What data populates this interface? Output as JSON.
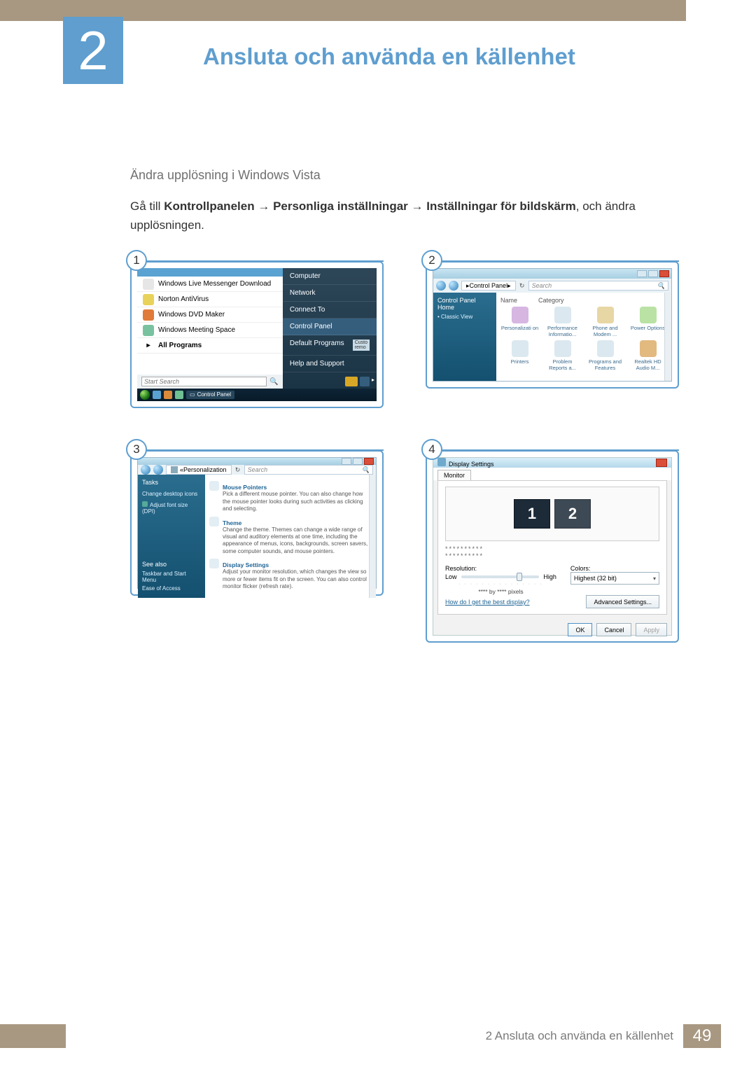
{
  "chapter": {
    "number": "2",
    "title": "Ansluta och använda en källenhet"
  },
  "section": {
    "subheading": "Ändra upplösning i Windows Vista",
    "intro_prefix": "Gå till ",
    "path_parts": [
      "Kontrollpanelen",
      "Personliga inställningar",
      "Inställningar för bildskärm"
    ],
    "intro_suffix": ", och ändra upplösningen."
  },
  "screens": {
    "s1": {
      "badge": "1",
      "left_items": [
        "Windows Live Messenger Download",
        "Norton AntiVirus",
        "Windows DVD Maker",
        "Windows Meeting Space"
      ],
      "all_programs": "All Programs",
      "search_placeholder": "Start Search",
      "right_items": [
        "Computer",
        "Network",
        "Connect To",
        "Control Panel",
        "Default Programs",
        "Help and Support"
      ],
      "right_highlight": "Control Panel",
      "right_side_label": "Custo\nremo",
      "taskbar_label": "Control Panel"
    },
    "s2": {
      "badge": "2",
      "breadcrumb": "Control Panel",
      "search_placeholder": "Search",
      "side_header": "Control Panel Home",
      "side_links": [
        "Classic View"
      ],
      "columns": [
        "Name",
        "Category"
      ],
      "items": [
        "Personalizati on",
        "Performance Informatio...",
        "Phone and Modem ...",
        "Power Options",
        "Printers",
        "Problem Reports a...",
        "Programs and Features",
        "Realtek HD Audio M..."
      ]
    },
    "s3": {
      "badge": "3",
      "breadcrumb": "Personalization",
      "search_placeholder": "Search",
      "side_header": "Tasks",
      "side_links": [
        "Change desktop icons",
        "Adjust font size (DPI)"
      ],
      "side_footer_header": "See also",
      "side_footer_links": [
        "Taskbar and Start Menu",
        "Ease of Access"
      ],
      "items": [
        {
          "title": "Mouse Pointers",
          "desc": "Pick a different mouse pointer. You can also change how the mouse pointer looks during such activities as clicking and selecting."
        },
        {
          "title": "Theme",
          "desc": "Change the theme. Themes can change a wide range of visual and auditory elements at one time, including the appearance of menus, icons, backgrounds, screen savers, some computer sounds, and mouse pointers."
        },
        {
          "title": "Display Settings",
          "desc": "Adjust your monitor resolution, which changes the view so more or fewer items fit on the screen. You can also control monitor flicker (refresh rate)."
        }
      ]
    },
    "s4": {
      "badge": "4",
      "title": "Display Settings",
      "tab": "Monitor",
      "monitors": [
        "1",
        "2"
      ],
      "dots1": "**********",
      "dots2": "**********",
      "resolution_label": "Resolution:",
      "res_low": "Low",
      "res_high": "High",
      "res_value": "**** by **** pixels",
      "colors_label": "Colors:",
      "colors_value": "Highest (32 bit)",
      "help_link": "How do I get the best display?",
      "adv_button": "Advanced Settings...",
      "ok": "OK",
      "cancel": "Cancel",
      "apply": "Apply"
    }
  },
  "footer": {
    "label": "2 Ansluta och använda en källenhet",
    "page": "49"
  }
}
